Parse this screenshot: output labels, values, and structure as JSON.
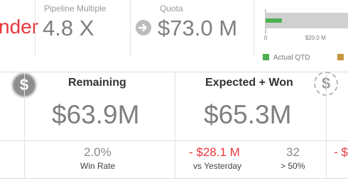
{
  "top": {
    "left_fragment": "nder",
    "pipeline": {
      "label": "Pipeline Multiple",
      "value": "4.8 X"
    },
    "quota": {
      "label": "Quota",
      "value": "$73.0 M",
      "icon": "arrow-right-circle-icon"
    },
    "minichart": {
      "tick_0": "0",
      "tick_1": "$20.0 M",
      "legend_actual": "Actual QTD",
      "colors": {
        "actual": "#4caf50",
        "other": "#c8963e",
        "track": "#d0d0d0"
      }
    }
  },
  "cards": {
    "remaining": {
      "title": "Remaining",
      "value": "$63.9M",
      "icon": "dollar-circle-icon"
    },
    "expected": {
      "title": "Expected + Won",
      "value": "$65.3M",
      "icon": "dollar-dashed-circle-icon"
    }
  },
  "stats": {
    "win_rate": {
      "value": "2.0%",
      "label": "Win Rate"
    },
    "vs_yesterday": {
      "value": "- $28.1 M",
      "label": "vs Yesterday"
    },
    "over50": {
      "value": "32",
      "label": "> 50%"
    },
    "right_fragment": "- $"
  },
  "chart_data": {
    "type": "bar",
    "orientation": "horizontal",
    "categories": [
      "Actual QTD"
    ],
    "values": [
      6.5
    ],
    "ticks": [
      "0",
      "$20.0 M"
    ],
    "xlim": [
      0,
      33
    ]
  }
}
